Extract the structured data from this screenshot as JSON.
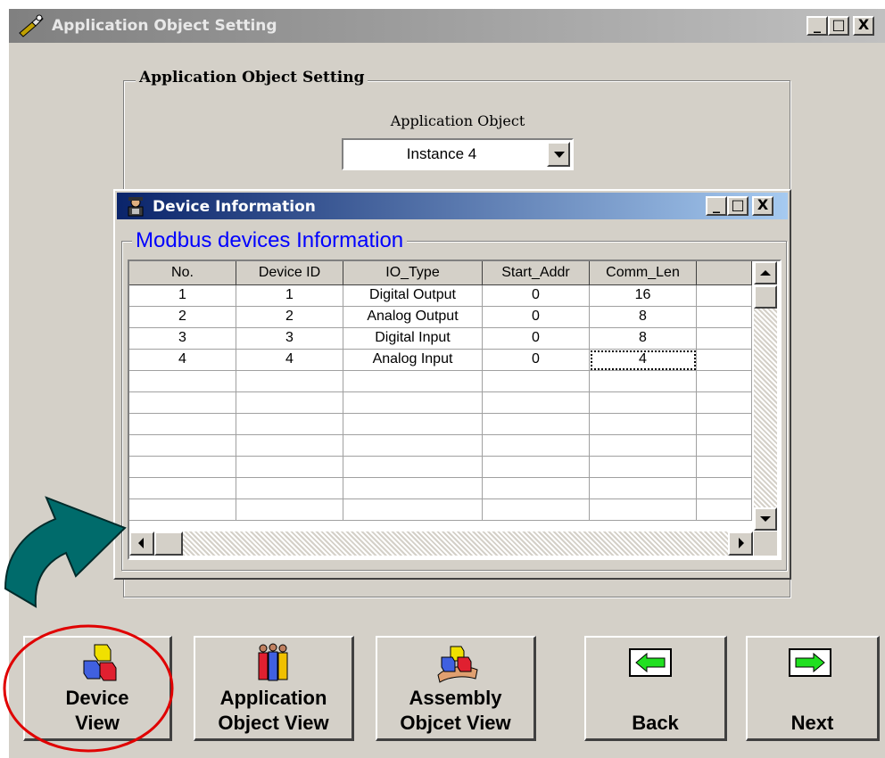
{
  "main_window": {
    "title": "Application Object Setting",
    "controls": [
      "_",
      "□",
      "X"
    ]
  },
  "settings_group": {
    "label": "Application Object Setting",
    "field_label": "Application Object",
    "selected_value": "Instance 4"
  },
  "device_window": {
    "title": "Device Information",
    "controls": [
      "_",
      "□",
      "X"
    ],
    "group_label": "Modbus devices Information",
    "columns": [
      "No.",
      "Device ID",
      "IO_Type",
      "Start_Addr",
      "Comm_Len"
    ],
    "rows": [
      [
        "1",
        "1",
        "Digital Output",
        "0",
        "16"
      ],
      [
        "2",
        "2",
        "Analog Output",
        "0",
        "8"
      ],
      [
        "3",
        "3",
        "Digital Input",
        "0",
        "8"
      ],
      [
        "4",
        "4",
        "Analog Input",
        "0",
        "4"
      ]
    ]
  },
  "buttons": {
    "device_view": [
      "Device",
      "View"
    ],
    "app_object_view": [
      "Application",
      "Object View"
    ],
    "assembly_view": [
      "Assembly",
      "Objcet View"
    ],
    "back": "Back",
    "next": "Next"
  },
  "colors": {
    "window_bg": "#d4d0c8",
    "active_title": "#0a246a",
    "group_label_blue": "#0000ff",
    "annotation_arrow": "#006b6b",
    "annotation_circle": "#e00000"
  },
  "icons": [
    "wrench-icon",
    "device-info-icon",
    "cubes-icon",
    "people-icon",
    "hand-cubes-icon",
    "back-arrow-icon",
    "next-arrow-icon"
  ]
}
